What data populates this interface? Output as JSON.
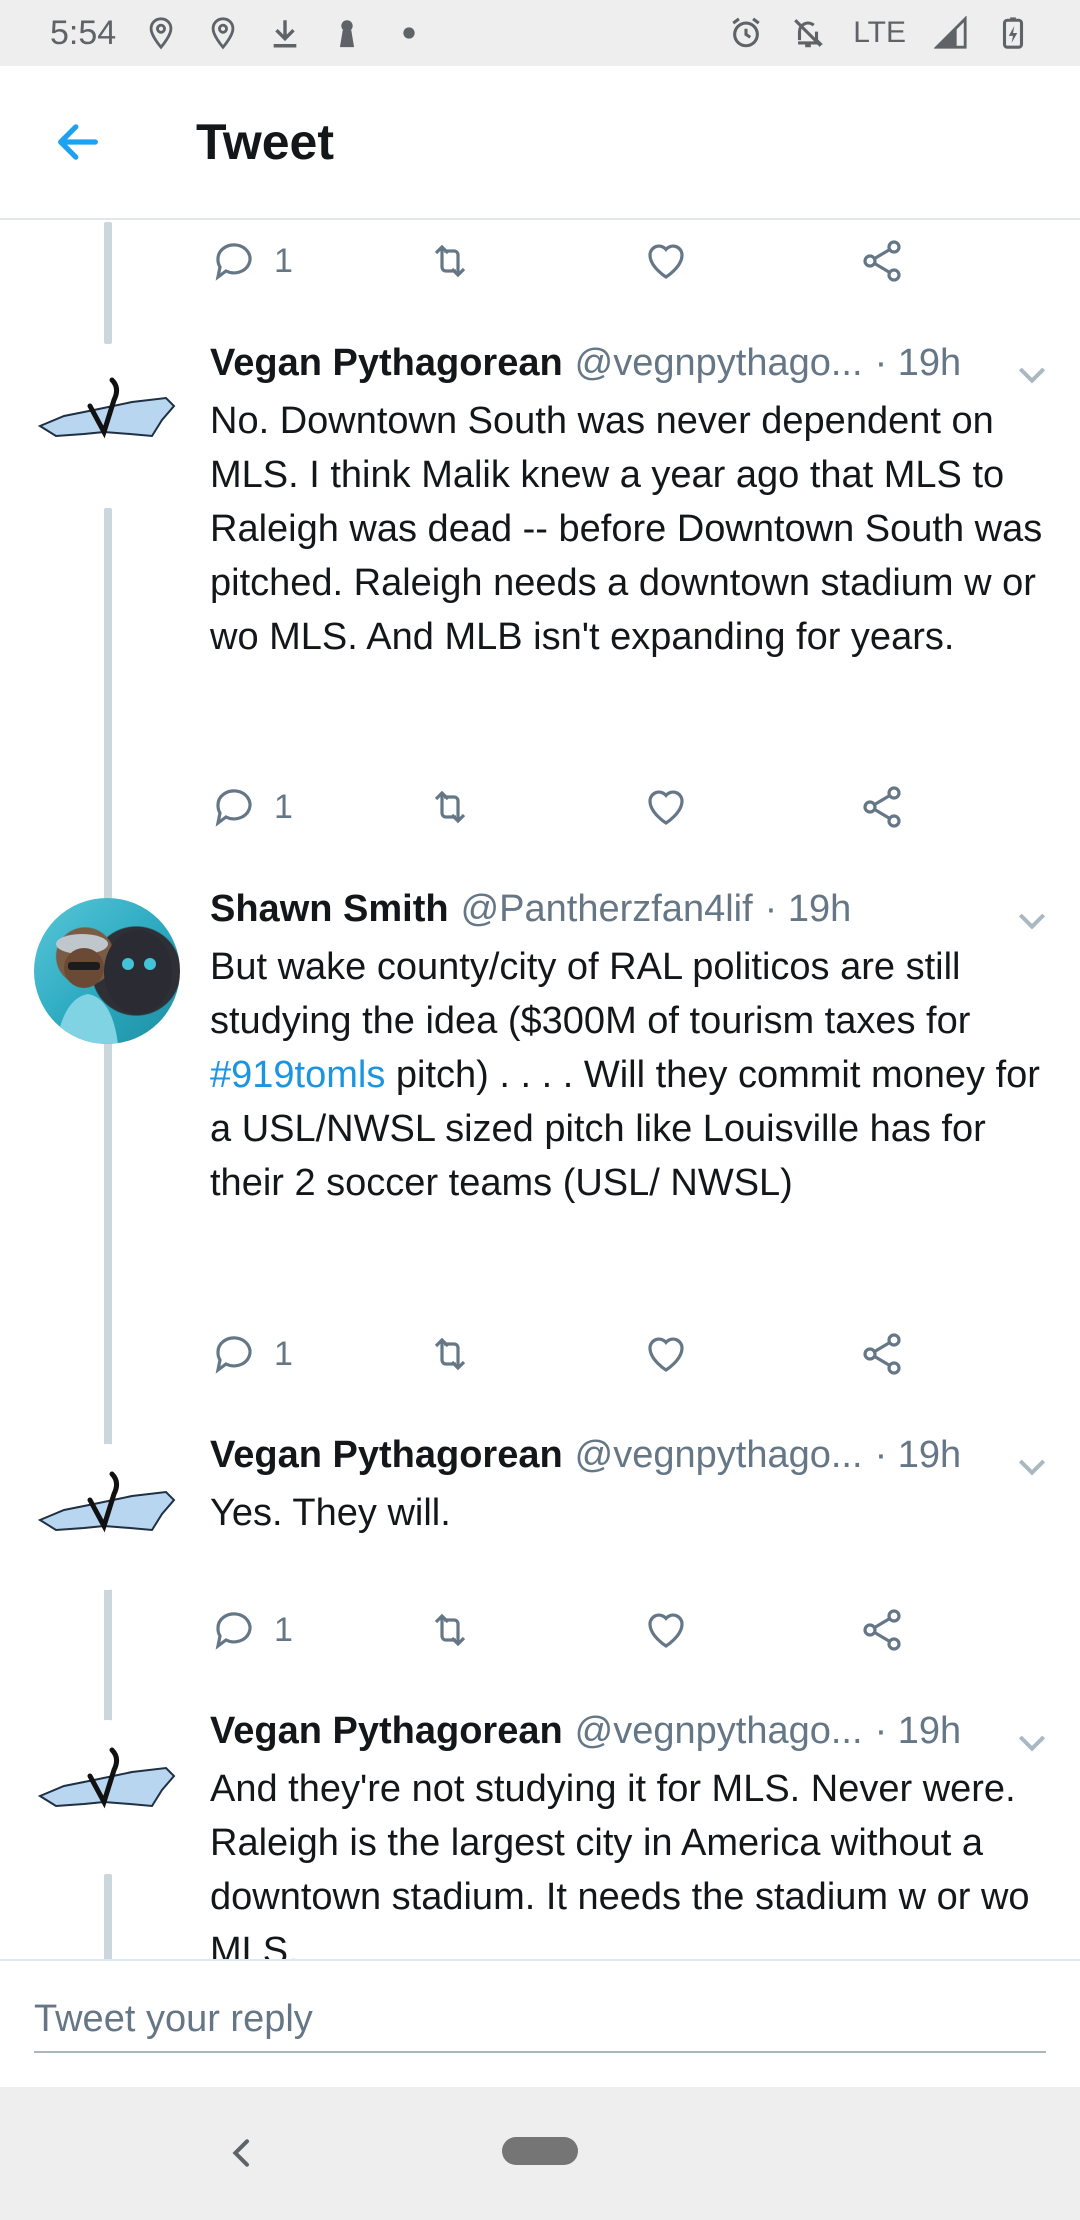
{
  "status_bar": {
    "time": "5:54",
    "network": "LTE",
    "left_icons": [
      "location-pin-icon",
      "location-pin-icon",
      "download-icon",
      "keyhole-icon",
      "dot-icon"
    ],
    "right_icons": [
      "alarm-icon",
      "notifications-off-icon",
      "signal-icon",
      "battery-charging-icon"
    ]
  },
  "app_bar": {
    "title": "Tweet",
    "back_icon": "arrow-left-icon",
    "accent_color": "#1da1f2"
  },
  "tweets": [
    {
      "partial": true,
      "reply_count": "1"
    },
    {
      "name": "Vegan Pythagorean",
      "handle": "@vegnpythago...",
      "time": "· 19h",
      "avatar": "north-carolina-map-avatar",
      "text": "No. Downtown South was never dependent on MLS. I think Malik knew a year ago that MLS to Raleigh was dead -- before Downtown South was pitched. Raleigh needs a downtown stadium w or wo MLS. And MLB isn't expanding for years.",
      "reply_count": "1"
    },
    {
      "name": "Shawn Smith",
      "handle": "@Pantherzfan4lif",
      "time": "· 19h",
      "avatar": "user-photo-avatar",
      "text_before": "But wake county/city of RAL politicos are still studying the idea ($300M of tourism taxes for",
      "hashtag": "#919tomls",
      "text_after": "pitch)  . . . . Will they commit money for a USL/NWSL sized pitch like Louisville has for their 2 soccer teams (USL/ NWSL)",
      "reply_count": "1"
    },
    {
      "name": "Vegan Pythagorean",
      "handle": "@vegnpythago...",
      "time": "· 19h",
      "avatar": "north-carolina-map-avatar",
      "text": "Yes. They will.",
      "reply_count": "1"
    },
    {
      "name": "Vegan Pythagorean",
      "handle": "@vegnpythago...",
      "time": "· 19h",
      "avatar": "north-carolina-map-avatar",
      "text": "And they're not studying it for MLS. Never were. Raleigh is the largest city in America without a downtown stadium. It needs the stadium w or wo MLS."
    }
  ],
  "reply_bar": {
    "placeholder": "Tweet your reply"
  },
  "colors": {
    "text": "#14171a",
    "secondary": "#657786",
    "link": "#1b95e0",
    "thread_line": "#ccd6dd"
  }
}
